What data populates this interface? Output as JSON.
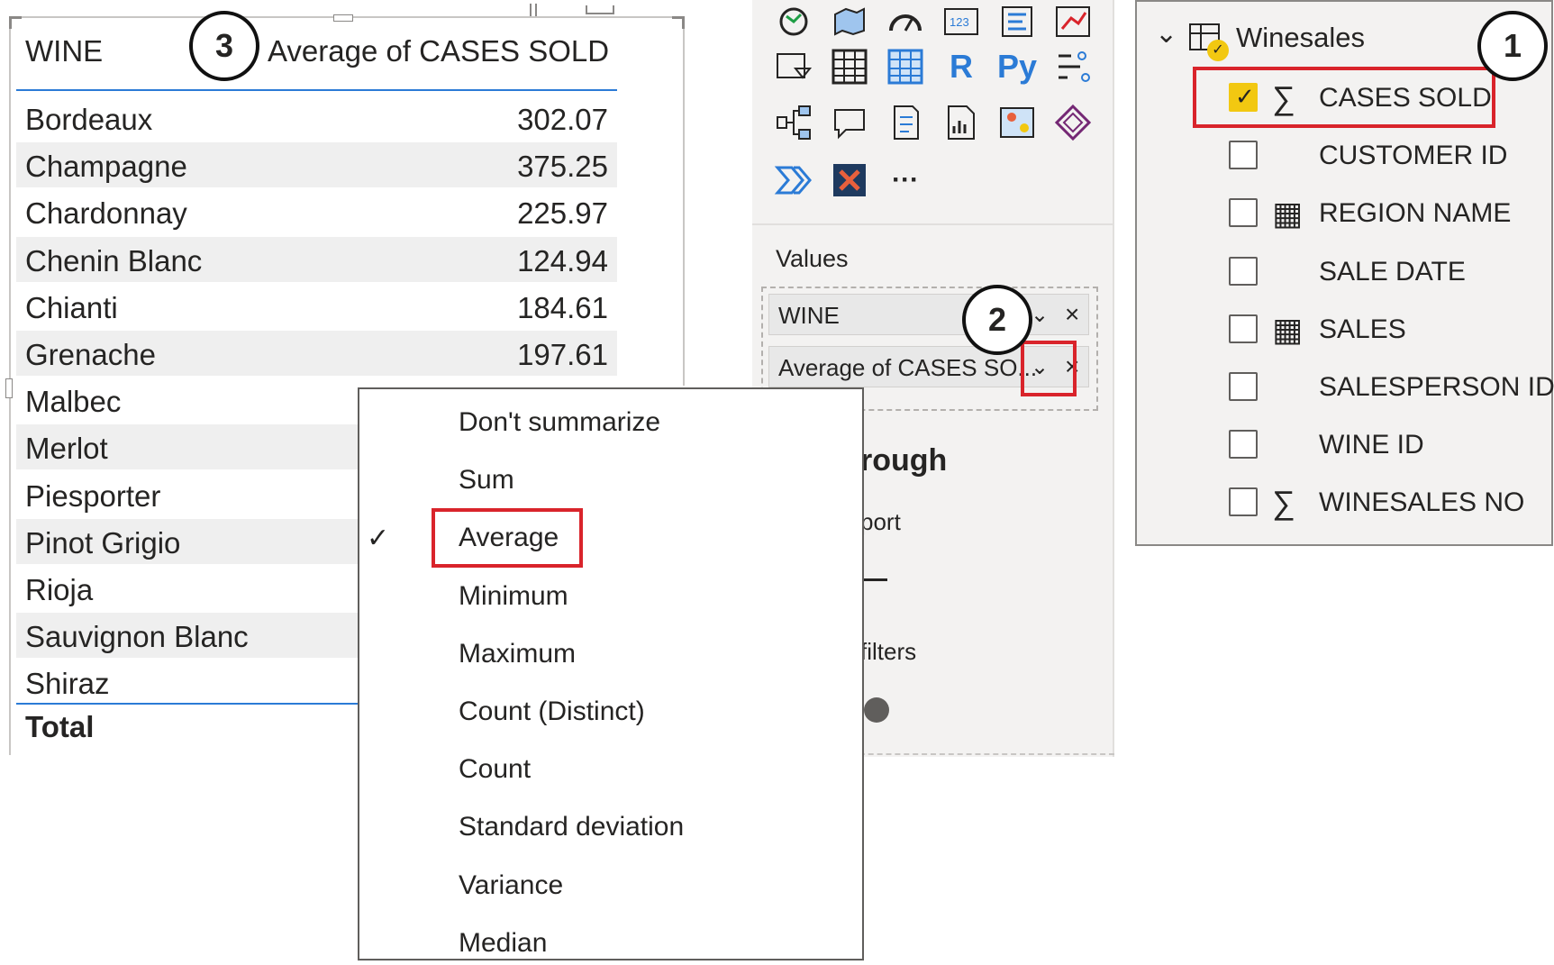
{
  "table_visual": {
    "columns": [
      "WINE",
      "Average of CASES SOLD"
    ],
    "rows": [
      {
        "wine": "Bordeaux",
        "value": "302.07"
      },
      {
        "wine": "Champagne",
        "value": "375.25"
      },
      {
        "wine": "Chardonnay",
        "value": "225.97"
      },
      {
        "wine": "Chenin Blanc",
        "value": "124.94"
      },
      {
        "wine": "Chianti",
        "value": "184.61"
      },
      {
        "wine": "Grenache",
        "value": "197.61"
      },
      {
        "wine": "Malbec",
        "value": ""
      },
      {
        "wine": "Merlot",
        "value": ""
      },
      {
        "wine": "Piesporter",
        "value": ""
      },
      {
        "wine": "Pinot Grigio",
        "value": ""
      },
      {
        "wine": "Rioja",
        "value": ""
      },
      {
        "wine": "Sauvignon Blanc",
        "value": ""
      },
      {
        "wine": "Shiraz",
        "value": ""
      }
    ],
    "total_label": "Total"
  },
  "callouts": {
    "one": "1",
    "two": "2",
    "three": "3"
  },
  "visualizations": {
    "icons": [
      "map-icon",
      "filled-map-icon",
      "gauge-icon",
      "card-icon",
      "multi-row-card-icon",
      "kpi-icon",
      "slicer-icon",
      "table-icon",
      "matrix-icon",
      "r-visual-icon",
      "python-visual-icon",
      "key-influencers-icon",
      "decomposition-tree-icon",
      "qa-icon",
      "smart-narrative-icon",
      "paginated-report-icon",
      "azure-map-icon",
      "power-apps-icon",
      "power-automate-icon",
      "custom-visual-icon",
      "more-visuals-icon"
    ],
    "r_label": "R",
    "py_label": "Py",
    "more_label": "···",
    "values_title": "Values",
    "value_fields": [
      {
        "label": "WINE"
      },
      {
        "label": "Average of CASES SO..."
      }
    ],
    "drillthrough_partial": "rough",
    "report_partial": "port",
    "filters_partial": "filters"
  },
  "fields": {
    "table_name": "Winesales",
    "items": [
      {
        "name": "CASES SOLD",
        "checked": true,
        "icon": "sigma-icon"
      },
      {
        "name": "CUSTOMER ID",
        "checked": false,
        "icon": ""
      },
      {
        "name": "REGION NAME",
        "checked": false,
        "icon": "calculated-column-icon"
      },
      {
        "name": "SALE DATE",
        "checked": false,
        "icon": ""
      },
      {
        "name": "SALES",
        "checked": false,
        "icon": "calculated-table-icon"
      },
      {
        "name": "SALESPERSON ID",
        "checked": false,
        "icon": ""
      },
      {
        "name": "WINE ID",
        "checked": false,
        "icon": ""
      },
      {
        "name": "WINESALES NO",
        "checked": false,
        "icon": "sigma-icon"
      }
    ]
  },
  "summarize_menu": {
    "items": [
      "Don't summarize",
      "Sum",
      "Average",
      "Minimum",
      "Maximum",
      "Count (Distinct)",
      "Count",
      "Standard deviation",
      "Variance",
      "Median"
    ],
    "selected": "Average"
  },
  "colors": {
    "highlight_red": "#d9242b",
    "accent_blue": "#2b7bd6",
    "checkbox_yellow": "#f2c811"
  }
}
